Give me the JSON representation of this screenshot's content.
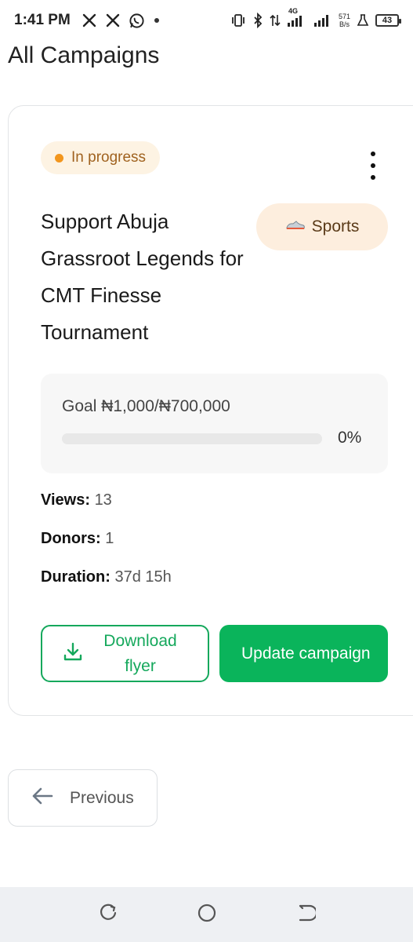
{
  "status_bar": {
    "time": "1:41 PM",
    "icons_left": [
      "x-icon",
      "x-icon",
      "whatsapp-icon",
      "dot-icon"
    ],
    "network_label": "4G",
    "speed_value": "571",
    "speed_unit": "B/s",
    "battery": "43"
  },
  "page": {
    "title": "All Campaigns"
  },
  "campaign": {
    "status": "In progress",
    "status_color": "#f2961d",
    "title": "Support Abuja Grassroot Legends for CMT Finesse Tournament",
    "category": "Sports",
    "category_icon": "sports-shoe-icon",
    "goal_label": "Goal",
    "goal_value": "₦1,000/₦700,000",
    "progress": 0,
    "progress_label": "0%",
    "views_label": "Views:",
    "views_value": "13",
    "donors_label": "Donors:",
    "donors_value": "1",
    "duration_label": "Duration:",
    "duration_value": "37d 15h",
    "download_label": "Download flyer",
    "update_label": "Update campaign"
  },
  "pagination": {
    "previous_label": "Previous"
  },
  "colors": {
    "accent": "#0ab45b",
    "status_bg": "#fdf3e3",
    "category_bg": "#fdeede"
  }
}
